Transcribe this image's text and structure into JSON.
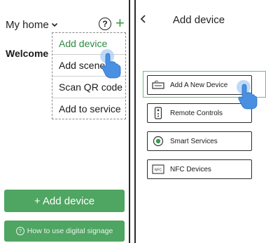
{
  "left": {
    "title": "My home",
    "chevron_icon": "chevron-down-icon",
    "help_icon": "question-circle-icon",
    "add_icon": "plus-icon",
    "welcome": "Welcome h",
    "menu": {
      "items": [
        {
          "label": "Add device",
          "active": true
        },
        {
          "label": "Add scene",
          "active": false
        },
        {
          "label": "Scan QR code",
          "active": false
        },
        {
          "label": "Add to service",
          "active": false
        }
      ]
    },
    "add_device_button": "+ Add device",
    "howto_button": "How to use digital signage",
    "howto_icon_glyph": "?"
  },
  "right": {
    "back_icon": "chevron-left-icon",
    "title": "Add device",
    "items": [
      {
        "label": "Add A New Device",
        "icon": "add-device-icon"
      },
      {
        "label": "Remote Controls",
        "icon": "remote-control-icon"
      },
      {
        "label": "Smart Services",
        "icon": "smart-services-icon"
      },
      {
        "label": "NFC Devices",
        "icon": "nfc-icon"
      }
    ],
    "nfc_icon_text": "NFC"
  },
  "colors": {
    "accent_green": "#4fa562",
    "active_text_green": "#2f8a45",
    "highlight_border": "#6dbb7b",
    "hand_blue": "#4a90e2"
  }
}
